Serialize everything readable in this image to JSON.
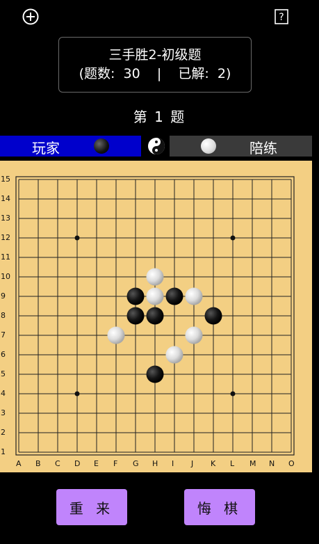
{
  "top_bar": {
    "add_icon": "plus-circle-icon",
    "help_icon": "help-question-icon"
  },
  "title_box": {
    "title": "三手胜2-初级题",
    "subtitle": "(题数:  30    |    已解:  2)"
  },
  "problem_label": "第 1 题",
  "player": {
    "label": "玩家",
    "stone": "black"
  },
  "opponent": {
    "label": "陪练",
    "stone": "white"
  },
  "center_icon": "yin-yang-icon",
  "board": {
    "size": 15,
    "columns": [
      "A",
      "B",
      "C",
      "D",
      "E",
      "F",
      "G",
      "H",
      "I",
      "J",
      "K",
      "L",
      "M",
      "N",
      "O"
    ],
    "rows": [
      "15",
      "14",
      "13",
      "12",
      "11",
      "10",
      "9",
      "8",
      "7",
      "6",
      "5",
      "4",
      "3",
      "2",
      "1"
    ],
    "star_points": [
      "D12",
      "L12",
      "D4",
      "L4"
    ],
    "stones": [
      {
        "pos": "H10",
        "color": "white"
      },
      {
        "pos": "G9",
        "color": "black"
      },
      {
        "pos": "H9",
        "color": "white"
      },
      {
        "pos": "I9",
        "color": "black"
      },
      {
        "pos": "J9",
        "color": "white"
      },
      {
        "pos": "G8",
        "color": "black"
      },
      {
        "pos": "H8",
        "color": "black"
      },
      {
        "pos": "K8",
        "color": "black"
      },
      {
        "pos": "F7",
        "color": "white"
      },
      {
        "pos": "J7",
        "color": "white"
      },
      {
        "pos": "I6",
        "color": "white"
      },
      {
        "pos": "H5",
        "color": "black"
      }
    ]
  },
  "buttons": {
    "restart": "重 来",
    "undo": "悔 棋"
  },
  "colors": {
    "board": "#f3cf83",
    "player_bar": "#0000cc",
    "opponent_bar": "#3a3a3a",
    "button": "#c084fc"
  }
}
